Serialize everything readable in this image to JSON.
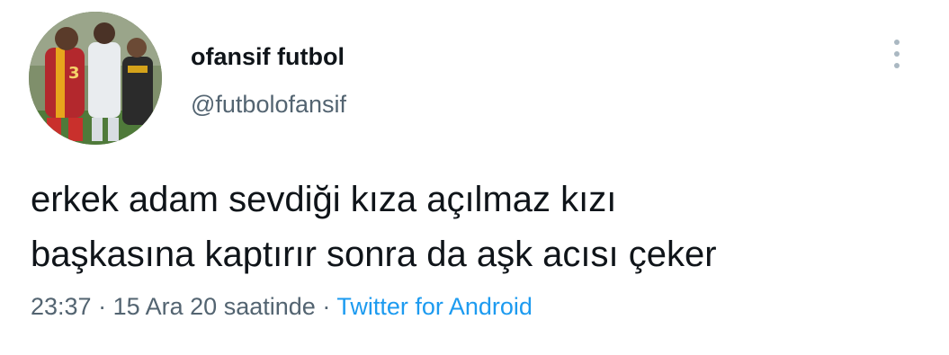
{
  "author": {
    "display_name": "ofansif futbol",
    "handle": "@futbolofansif",
    "avatar_icon": "profile-photo"
  },
  "tweet": {
    "lines": [
      "erkek adam sevdiği kıza açılmaz kızı",
      "başkasına kaptırır sonra da aşk acısı çeker"
    ]
  },
  "meta": {
    "time": "23:37",
    "separator": "·",
    "date": "15 Ara 20 saatinde",
    "source": "Twitter for Android"
  },
  "colors": {
    "text": "#0f1419",
    "secondary": "#536471",
    "link": "#1d9bf0"
  },
  "icons": {
    "more": "vertical-ellipsis-icon"
  }
}
